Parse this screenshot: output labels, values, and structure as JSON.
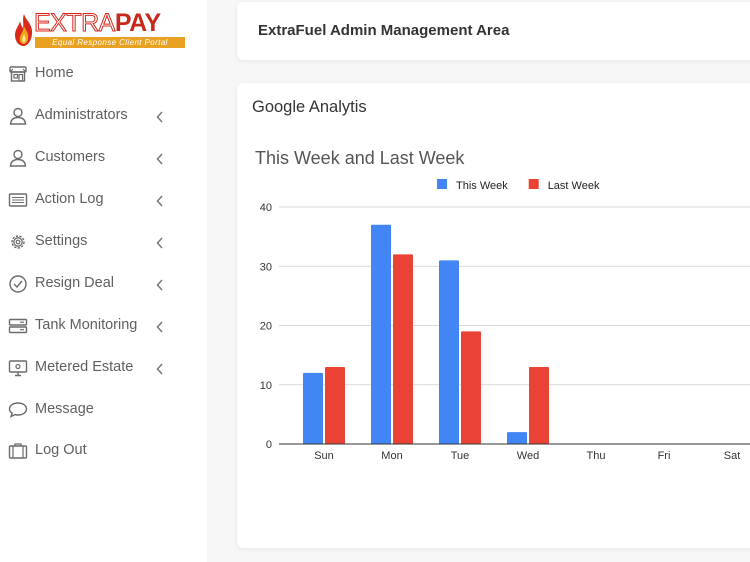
{
  "brand": {
    "name_part1": "EXTRA",
    "name_part2": "PAY",
    "tagline": "Equal Response Client Portal"
  },
  "sidebar": {
    "items": [
      {
        "label": "Home",
        "icon": "home-icon",
        "has_submenu": false
      },
      {
        "label": "Administrators",
        "icon": "user-icon",
        "has_submenu": true
      },
      {
        "label": "Customers",
        "icon": "user-icon",
        "has_submenu": true
      },
      {
        "label": "Action Log",
        "icon": "list-icon",
        "has_submenu": true
      },
      {
        "label": "Settings",
        "icon": "gear-icon",
        "has_submenu": true
      },
      {
        "label": "Resign Deal",
        "icon": "clock-icon",
        "has_submenu": true
      },
      {
        "label": "Tank Monitoring",
        "icon": "tank-icon",
        "has_submenu": true
      },
      {
        "label": "Metered Estate",
        "icon": "monitor-icon",
        "has_submenu": true
      },
      {
        "label": "Message",
        "icon": "chat-icon",
        "has_submenu": false
      },
      {
        "label": "Log Out",
        "icon": "logout-icon",
        "has_submenu": false
      }
    ]
  },
  "header": {
    "title": "ExtraFuel Admin Management Area"
  },
  "analytics": {
    "title": "Google Analytis"
  },
  "chart_data": {
    "type": "bar",
    "title": "This Week and Last Week",
    "categories": [
      "Sun",
      "Mon",
      "Tue",
      "Wed",
      "Thu",
      "Fri",
      "Sat"
    ],
    "series": [
      {
        "name": "This Week",
        "color": "#4285f4",
        "values": [
          12,
          37,
          31,
          2,
          0,
          0,
          0
        ]
      },
      {
        "name": "Last Week",
        "color": "#ea4335",
        "values": [
          13,
          32,
          19,
          13,
          0,
          0,
          0
        ]
      }
    ],
    "yticks": [
      "0",
      "10",
      "20",
      "30",
      "40"
    ],
    "ylim": [
      0,
      40
    ],
    "grid": true,
    "legend": "top-center"
  }
}
